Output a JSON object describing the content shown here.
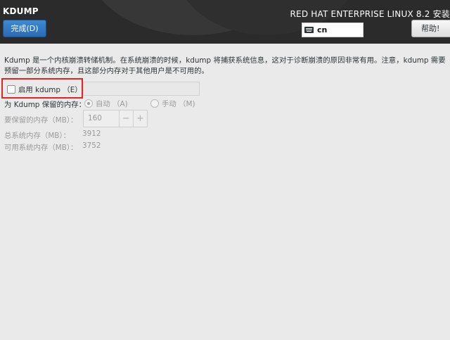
{
  "header": {
    "spoke_title": "KDUMP",
    "done_label": "完成(D)",
    "product_title": "RED HAT ENTERPRISE LINUX 8.2 安装",
    "keyboard_layout": "cn",
    "keyboard_icon": "keyboard-icon",
    "help_label": "帮助!"
  },
  "content": {
    "description": "Kdump 是一个内核崩溃转储机制。在系统崩溃的时候，kdump 将捕获系统信息，这对于诊断崩溃的原因非常有用。注意，kdump 需要预留一部分系统内存，且这部分内存对于其他用户是不可用的。",
    "enable_label": "启用 kdump （E）",
    "enable_checked": false,
    "reserve_label": "为 Kdump 保留的内存：",
    "reserve_options": [
      {
        "label": "自动 （A)",
        "selected": true
      },
      {
        "label": "手动 （M)",
        "selected": false
      }
    ],
    "reserved_memory_label": "要保留的内存（MB）：",
    "reserved_memory_value": "160",
    "decrement_symbol": "−",
    "increment_symbol": "+",
    "total_memory_label": "总系统内存（MB）：",
    "total_memory_value": "3912",
    "usable_memory_label": "可用系统内存（MB）：",
    "usable_memory_value": "3752"
  },
  "colors": {
    "header_bg": "#2b2b2b",
    "accent_blue": "#2a6bb4",
    "highlight_red": "#e02525"
  }
}
